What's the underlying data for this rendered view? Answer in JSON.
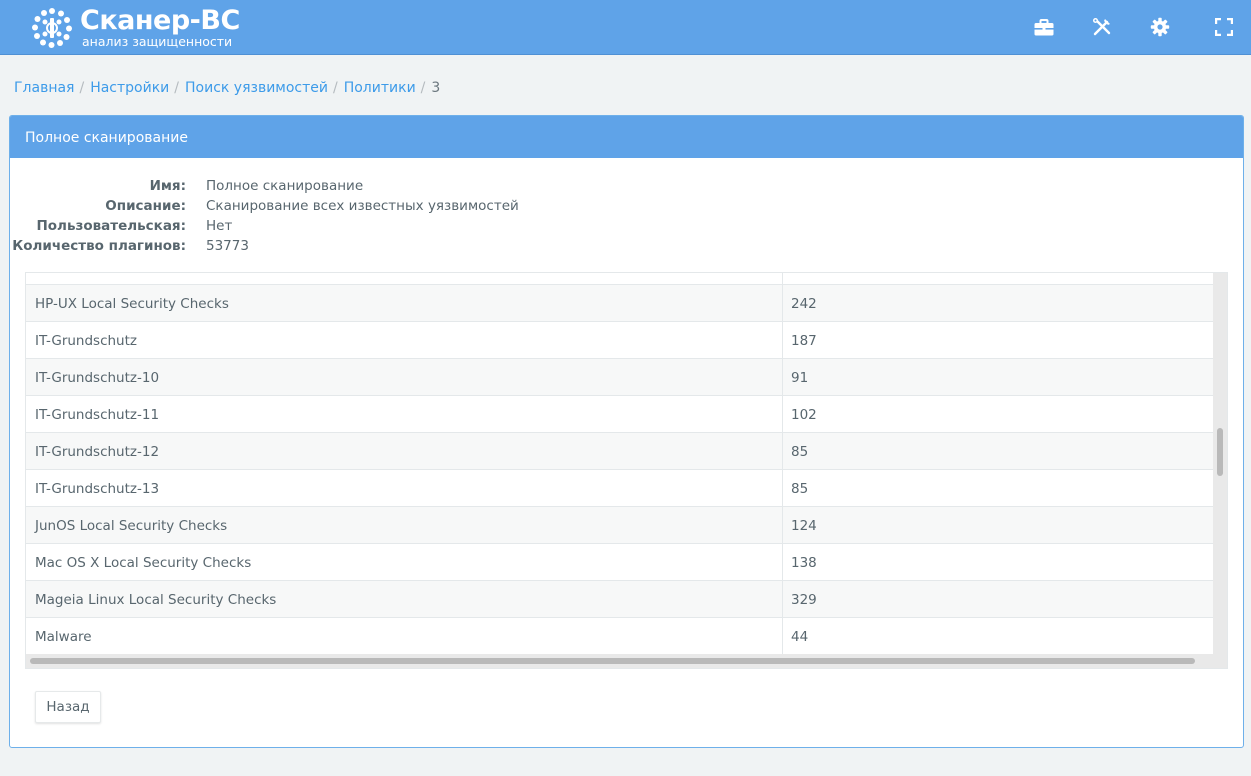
{
  "app": {
    "title": "Сканер-ВС",
    "subtitle": "анализ защищенности"
  },
  "topbar": {
    "icons": [
      "briefcase-icon",
      "tools-icon",
      "gear-icon",
      "fullscreen-icon"
    ]
  },
  "breadcrumb": {
    "items": [
      "Главная",
      "Настройки",
      "Поиск уязвимостей",
      "Политики"
    ],
    "current": "3"
  },
  "panel": {
    "title": "Полное сканирование",
    "info": [
      {
        "label": "Имя:",
        "value": "Полное сканирование"
      },
      {
        "label": "Описание:",
        "value": "Сканирование всех известных уязвимостей"
      },
      {
        "label": "Пользовательская:",
        "value": "Нет"
      },
      {
        "label": "Количество плагинов:",
        "value": "53773"
      }
    ]
  },
  "table": {
    "rows": [
      {
        "name": "",
        "count": ""
      },
      {
        "name": "HP-UX Local Security Checks",
        "count": "242"
      },
      {
        "name": "IT-Grundschutz",
        "count": "187"
      },
      {
        "name": "IT-Grundschutz-10",
        "count": "91"
      },
      {
        "name": "IT-Grundschutz-11",
        "count": "102"
      },
      {
        "name": "IT-Grundschutz-12",
        "count": "85"
      },
      {
        "name": "IT-Grundschutz-13",
        "count": "85"
      },
      {
        "name": "JunOS Local Security Checks",
        "count": "124"
      },
      {
        "name": "Mac OS X Local Security Checks",
        "count": "138"
      },
      {
        "name": "Mageia Linux Local Security Checks",
        "count": "329"
      },
      {
        "name": "Malware",
        "count": "44"
      },
      {
        "name": "",
        "count": ""
      }
    ]
  },
  "buttons": {
    "back": "Назад"
  },
  "colors": {
    "header": "#5fa3e8",
    "link": "#3d9be9",
    "text": "#58666e"
  }
}
